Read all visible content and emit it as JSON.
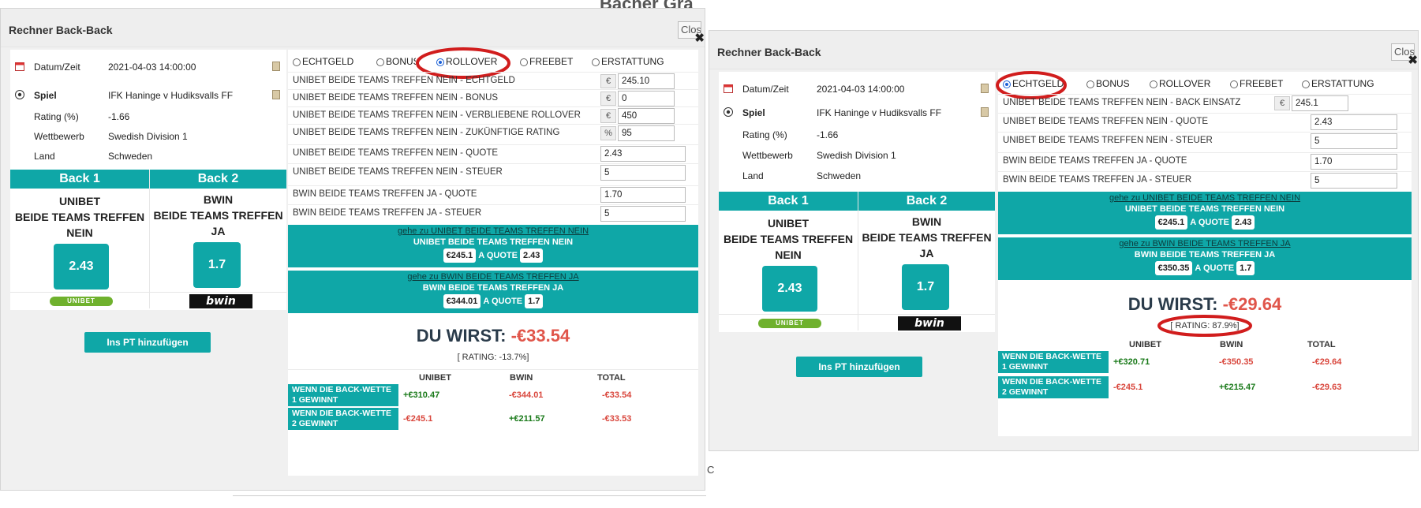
{
  "background": {
    "fragment_top": "Bacher Gra",
    "fragment_side": "C"
  },
  "calculators": [
    {
      "title": "Rechner Back-Back",
      "close_label": "Close",
      "info": {
        "date_label": "Datum/Zeit",
        "date_value": "2021-04-03 14:00:00",
        "game_label": "Spiel",
        "game_value": "IFK Haninge v Hudiksvalls FF",
        "rating_label": "Rating (%)",
        "rating_value": "-1.66",
        "competition_label": "Wettbewerb",
        "competition_value": "Swedish Division 1",
        "country_label": "Land",
        "country_value": "Schweden"
      },
      "backs": [
        {
          "head": "Back 1",
          "line1": "UNIBET",
          "line2": "BEIDE TEAMS TREFFEN",
          "line3": "NEIN",
          "odds": "2.43",
          "logo": "UNIBET"
        },
        {
          "head": "Back 2",
          "line1": "BWIN",
          "line2": "BEIDE TEAMS TREFFEN",
          "line3": "JA",
          "odds": "1.7",
          "logo": "bwin"
        }
      ],
      "pt_button": "Ins PT hinzufügen",
      "radios": [
        "ECHTGELD",
        "BONUS",
        "ROLLOVER",
        "FREEBET",
        "ERSTATTUNG"
      ],
      "radio_selected": "ROLLOVER",
      "fields": [
        {
          "label": "UNIBET BEIDE TEAMS TREFFEN NEIN - ECHTGELD",
          "unit": "€",
          "value": "245.10"
        },
        {
          "label": "UNIBET BEIDE TEAMS TREFFEN NEIN - BONUS",
          "unit": "€",
          "value": "0"
        },
        {
          "label": "UNIBET BEIDE TEAMS TREFFEN NEIN - VERBLIEBENE ROLLOVER",
          "unit": "€",
          "value": "450"
        },
        {
          "label": "UNIBET BEIDE TEAMS TREFFEN NEIN - ZUKÜNFTIGE RATING",
          "unit": "%",
          "value": "95"
        },
        {
          "label": "UNIBET BEIDE TEAMS TREFFEN NEIN - QUOTE",
          "unit": "",
          "value": "2.43"
        },
        {
          "label": "UNIBET BEIDE TEAMS TREFFEN NEIN - STEUER",
          "unit": "",
          "value": "5"
        },
        {
          "label": "BWIN BEIDE TEAMS TREFFEN JA  - QUOTE",
          "unit": "",
          "value": "1.70"
        },
        {
          "label": "BWIN BEIDE TEAMS TREFFEN JA - STEUER",
          "unit": "",
          "value": "5"
        }
      ],
      "gotos": [
        {
          "link": "gehe zu UNIBET BEIDE TEAMS TREFFEN NEIN",
          "name": "UNIBET BEIDE TEAMS TREFFEN NEIN",
          "stake": "€245.1",
          "a_quote": "A QUOTE",
          "odds": "2.43"
        },
        {
          "link": "gehe zu BWIN BEIDE TEAMS TREFFEN JA",
          "name": "BWIN BEIDE TEAMS TREFFEN JA",
          "stake": "€344.01",
          "a_quote": "A QUOTE",
          "odds": "1.7"
        }
      ],
      "result_label": "DU WIRST:",
      "result_value": "-€33.54",
      "rating_text": "[ RATING: -13.7%]",
      "table": {
        "headers": [
          "UNIBET",
          "BWIN",
          "TOTAL"
        ],
        "rows": [
          {
            "label": "WENN DIE BACK-WETTE 1 GEWINNT",
            "values": [
              "+€310.47",
              "-€344.01",
              "-€33.54"
            ]
          },
          {
            "label": "WENN DIE BACK-WETTE 2 GEWINNT",
            "values": [
              "-€245.1",
              "+€211.57",
              "-€33.53"
            ]
          }
        ]
      }
    },
    {
      "title": "Rechner Back-Back",
      "close_label": "Close",
      "info": {
        "date_label": "Datum/Zeit",
        "date_value": "2021-04-03 14:00:00",
        "game_label": "Spiel",
        "game_value": "IFK Haninge v Hudiksvalls FF",
        "rating_label": "Rating (%)",
        "rating_value": "-1.66",
        "competition_label": "Wettbewerb",
        "competition_value": "Swedish Division 1",
        "country_label": "Land",
        "country_value": "Schweden"
      },
      "backs": [
        {
          "head": "Back 1",
          "line1": "UNIBET",
          "line2": "BEIDE TEAMS TREFFEN",
          "line3": "NEIN",
          "odds": "2.43",
          "logo": "UNIBET"
        },
        {
          "head": "Back 2",
          "line1": "BWIN",
          "line2": "BEIDE TEAMS TREFFEN",
          "line3": "JA",
          "odds": "1.7",
          "logo": "bwin"
        }
      ],
      "pt_button": "Ins PT hinzufügen",
      "radios": [
        "ECHTGELD",
        "BONUS",
        "ROLLOVER",
        "FREEBET",
        "ERSTATTUNG"
      ],
      "radio_selected": "ECHTGELD",
      "fields": [
        {
          "label": "UNIBET BEIDE TEAMS TREFFEN NEIN - BACK EINSATZ",
          "unit": "€",
          "value": "245.1"
        },
        {
          "label": "UNIBET BEIDE TEAMS TREFFEN NEIN - QUOTE",
          "unit": "",
          "value": "2.43"
        },
        {
          "label": "UNIBET BEIDE TEAMS TREFFEN NEIN - STEUER",
          "unit": "",
          "value": "5"
        },
        {
          "label": "BWIN BEIDE TEAMS TREFFEN JA  - QUOTE",
          "unit": "",
          "value": "1.70"
        },
        {
          "label": "BWIN BEIDE TEAMS TREFFEN JA - STEUER",
          "unit": "",
          "value": "5"
        }
      ],
      "gotos": [
        {
          "link": "gehe zu UNIBET BEIDE TEAMS TREFFEN NEIN",
          "name": "UNIBET BEIDE TEAMS TREFFEN NEIN",
          "stake": "€245.1",
          "a_quote": "A QUOTE",
          "odds": "2.43"
        },
        {
          "link": "gehe zu BWIN BEIDE TEAMS TREFFEN JA",
          "name": "BWIN BEIDE TEAMS TREFFEN JA",
          "stake": "€350.35",
          "a_quote": "A QUOTE",
          "odds": "1.7"
        }
      ],
      "result_label": "DU WIRST:",
      "result_value": "-€29.64",
      "rating_text": "[ RATING: 87.9%]",
      "table": {
        "headers": [
          "UNIBET",
          "BWIN",
          "TOTAL"
        ],
        "rows": [
          {
            "label": "WENN DIE BACK-WETTE 1 GEWINNT",
            "values": [
              "+€320.71",
              "-€350.35",
              "-€29.64"
            ]
          },
          {
            "label": "WENN DIE BACK-WETTE 2 GEWINNT",
            "values": [
              "-€245.1",
              "+€215.47",
              "-€29.63"
            ]
          }
        ]
      }
    }
  ]
}
